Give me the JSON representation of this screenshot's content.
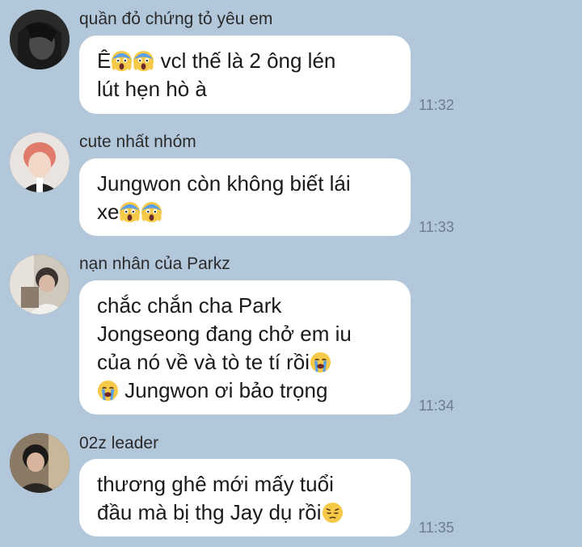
{
  "messages": [
    {
      "sender": "quần đỏ chứng tỏ yêu em",
      "lines": [
        [
          "Ê",
          "😱",
          "😱",
          " vcl thế là 2 ông lén"
        ],
        [
          "lút hẹn hò à"
        ]
      ],
      "time": "11:32"
    },
    {
      "sender": "cute nhất nhóm",
      "lines": [
        [
          "Jungwon còn không biết lái"
        ],
        [
          "xe",
          "😱",
          "😱"
        ]
      ],
      "time": "11:33"
    },
    {
      "sender": "nạn nhân của Parkz",
      "lines": [
        [
          "chắc chắn cha Park"
        ],
        [
          "Jongseong đang chở em iu"
        ],
        [
          "của nó về và tò te tí rồi",
          "😭"
        ],
        [
          "😭",
          " Jungwon ơi bảo trọng"
        ]
      ],
      "time": "11:34"
    },
    {
      "sender": "02z leader",
      "lines": [
        [
          "thương ghê mới mấy tuổi"
        ],
        [
          "đầu mà bị thg Jay dụ rồi",
          "😔"
        ]
      ],
      "time": "11:35"
    }
  ],
  "colors": {
    "background": "#b2c7da",
    "bubble": "#ffffff",
    "time": "#6b7d8e"
  }
}
